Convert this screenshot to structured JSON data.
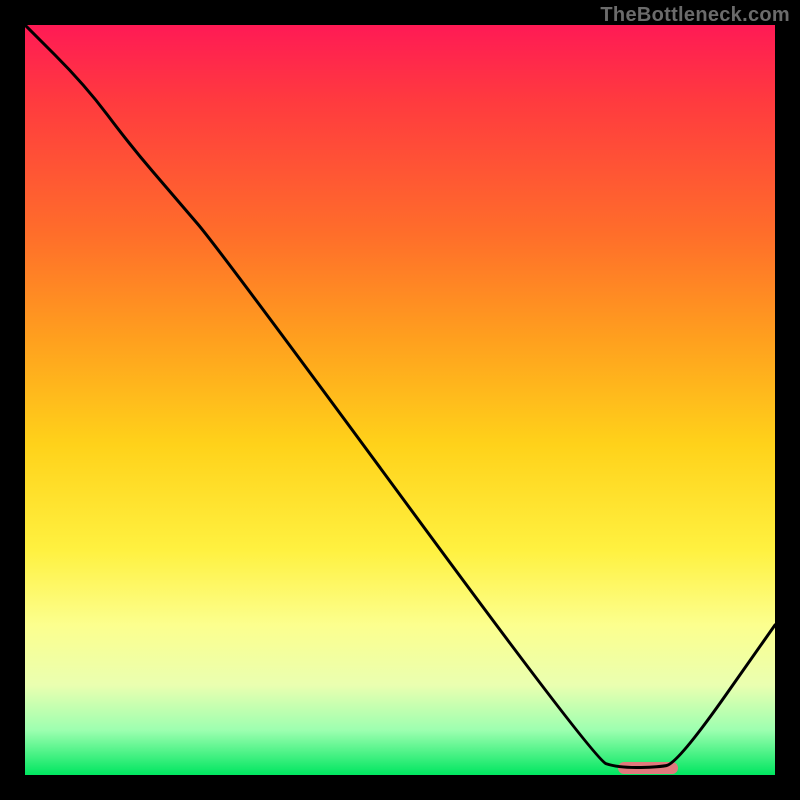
{
  "watermark": "TheBottleneck.com",
  "chart_data": {
    "type": "line",
    "title": "",
    "xlabel": "",
    "ylabel": "",
    "xlim": [
      0,
      100
    ],
    "ylim": [
      0,
      100
    ],
    "grid": false,
    "x": [
      0,
      8,
      14,
      20,
      26,
      76,
      79,
      84,
      87,
      100
    ],
    "values": [
      100,
      92,
      84,
      77,
      70,
      2,
      1,
      1,
      1.5,
      20
    ],
    "marker": {
      "x_start": 79,
      "x_end": 87,
      "y": 1
    },
    "notes": "y is a qualitative 'bottleneck severity' read from the color gradient; 100≈red (top), 0≈green (bottom). Curve descends from top-left through a knee around x≈20–26, reaches a flat minimum around x≈79–87, then rises toward x=100."
  },
  "gradient_colors": {
    "top": "#ff1a55",
    "upper_mid": "#ff6e2a",
    "mid": "#ffd21a",
    "lower_mid": "#fcff8e",
    "bottom": "#00e660"
  },
  "marker_color": "#e07a7d"
}
